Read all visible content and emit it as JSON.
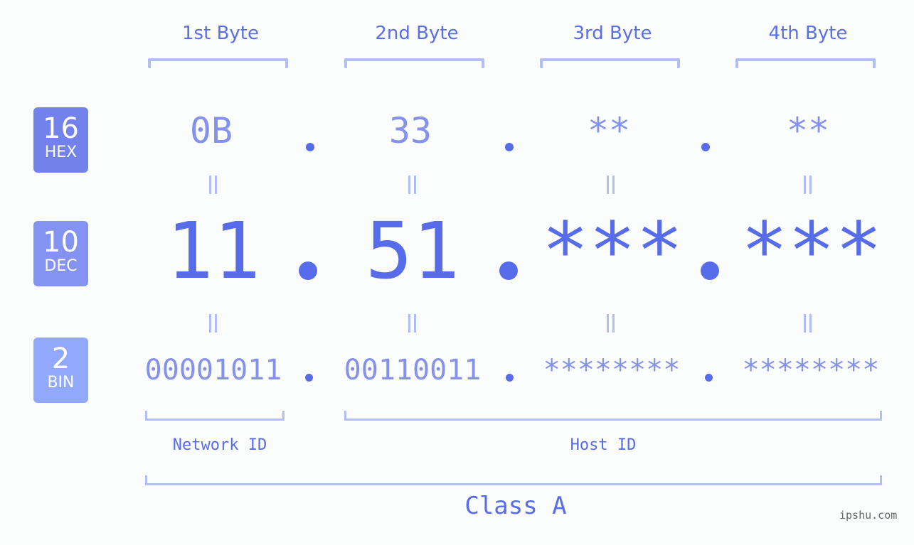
{
  "bytes": [
    {
      "header": "1st Byte",
      "hex": "0B",
      "dec": "11",
      "bin": "00001011"
    },
    {
      "header": "2nd Byte",
      "hex": "33",
      "dec": "51",
      "bin": "00110011"
    },
    {
      "header": "3rd Byte",
      "hex": "**",
      "dec": "***",
      "bin": "********"
    },
    {
      "header": "4th Byte",
      "hex": "**",
      "dec": "***",
      "bin": "********"
    }
  ],
  "bases": {
    "hex": {
      "number": "16",
      "label": "HEX",
      "color": "#7381ec"
    },
    "dec": {
      "number": "10",
      "label": "DEC",
      "color": "#8493f1"
    },
    "bin": {
      "number": "2",
      "label": "BIN",
      "color": "#91a8fb"
    }
  },
  "segments": {
    "network": "Network ID",
    "host": "Host ID"
  },
  "ip_class": "Class A",
  "watermark": "ipshu.com",
  "colors": {
    "primary": "#566cea",
    "light": "#8492ee",
    "bracket": "#b3bdf7",
    "background": "#fbfdfc"
  }
}
